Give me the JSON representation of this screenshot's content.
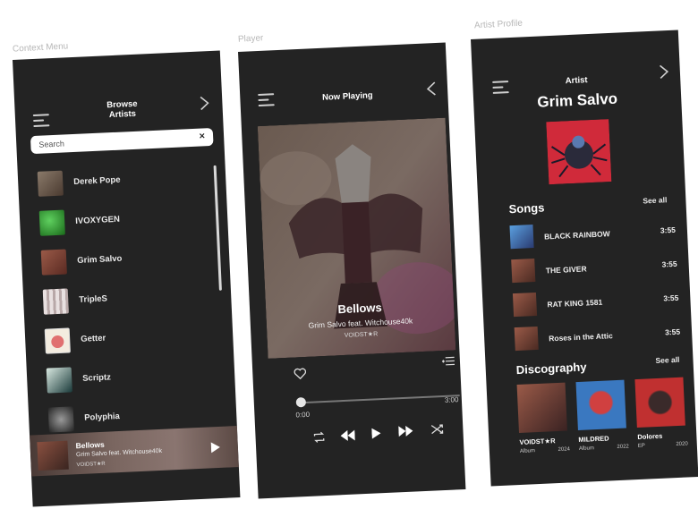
{
  "labels": {
    "context_menu": "Context Menu",
    "player": "Player",
    "artist_profile": "Artist Profile"
  },
  "context_menu": {
    "title_line1": "Browse",
    "title_line2": "Artists",
    "search_placeholder": "Search",
    "clear_glyph": "×",
    "artists": [
      {
        "name": "Derek Pope",
        "color": "#6a5a50"
      },
      {
        "name": "IVOXYGEN",
        "color": "#2e8a2e"
      },
      {
        "name": "Grim Salvo",
        "color": "#7a4438"
      },
      {
        "name": "TripleS",
        "color": "#d9d0d0"
      },
      {
        "name": "Getter",
        "color": "#f0e8d8"
      },
      {
        "name": "Scriptz",
        "color": "#2a4a4a"
      },
      {
        "name": "Polyphia",
        "color": "#3a3a3a"
      }
    ],
    "now_playing": {
      "song": "Bellows",
      "artist": "Grim Salvo feat. Witchouse40k",
      "album": "VOIDST★R"
    }
  },
  "player": {
    "title": "Now Playing",
    "song": "Bellows",
    "artist": "Grim Salvo feat. Witchouse40k",
    "album": "VOIDST★R",
    "elapsed": "0:00",
    "duration": "3:00",
    "progress": 0
  },
  "artist_profile": {
    "header": "Artist",
    "name": "Grim Salvo",
    "songs_heading": "Songs",
    "songs_see_all": "See all",
    "songs": [
      {
        "title": "BLACK RAINBOW",
        "duration": "3:55",
        "color": "#3a6ab0"
      },
      {
        "title": "THE GIVER",
        "duration": "3:55",
        "color": "#7a4438"
      },
      {
        "title": "RAT KING 1581",
        "duration": "3:55",
        "color": "#7a4438"
      },
      {
        "title": "Roses in the Attic",
        "duration": "3:55",
        "color": "#7a4438"
      }
    ],
    "discography_heading": "Discography",
    "discography_see_all": "See all",
    "discography": [
      {
        "title": "VOIDST★R",
        "type": "Album",
        "year": "2024",
        "color": "#7a4438"
      },
      {
        "title": "MILDRED",
        "type": "Album",
        "year": "2022",
        "color": "#3a78c0"
      },
      {
        "title": "Dolores",
        "type": "EP",
        "year": "2020",
        "color": "#c03030"
      }
    ]
  }
}
